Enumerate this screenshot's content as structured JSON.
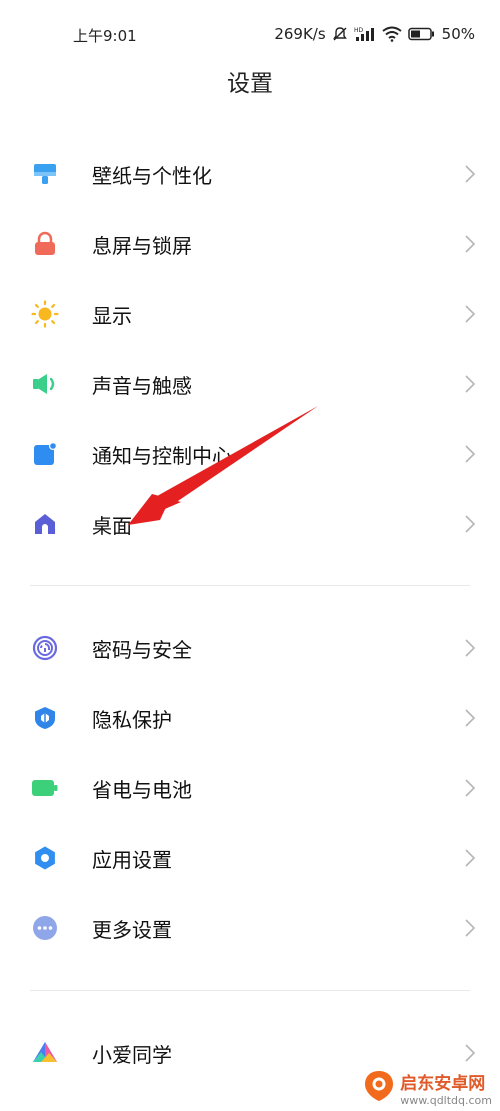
{
  "status": {
    "time": "上午9:01",
    "net_speed": "269K/s",
    "battery": "50%"
  },
  "title": "设置",
  "groups": [
    [
      {
        "label": "壁纸与个性化",
        "icon": "wallpaper-icon"
      },
      {
        "label": "息屏与锁屏",
        "icon": "lock-icon"
      },
      {
        "label": "显示",
        "icon": "sun-icon"
      },
      {
        "label": "声音与触感",
        "icon": "speaker-icon"
      },
      {
        "label": "通知与控制中心",
        "icon": "notification-icon"
      },
      {
        "label": "桌面",
        "icon": "home-icon"
      }
    ],
    [
      {
        "label": "密码与安全",
        "icon": "fingerprint-icon"
      },
      {
        "label": "隐私保护",
        "icon": "privacy-icon"
      },
      {
        "label": "省电与电池",
        "icon": "battery-icon"
      },
      {
        "label": "应用设置",
        "icon": "gear-icon"
      },
      {
        "label": "更多设置",
        "icon": "more-icon"
      }
    ],
    [
      {
        "label": "小爱同学",
        "icon": "xiaoai-icon"
      }
    ]
  ],
  "watermark": {
    "name": "启东安卓网",
    "url": "www.qdltdq.com"
  },
  "colors": {
    "wallpaper": "#3aa0f0",
    "lock": "#f06a5a",
    "sun": "#f8b820",
    "sound": "#3ccf8a",
    "notify": "#2f8cf0",
    "home": "#5a5fd8",
    "fingerprint": "#6a6ae0",
    "privacy": "#2f86e8",
    "battery": "#3cd07a",
    "gear": "#2f8ef0",
    "more": "#8fa6e8",
    "arrow": "#e52020"
  }
}
